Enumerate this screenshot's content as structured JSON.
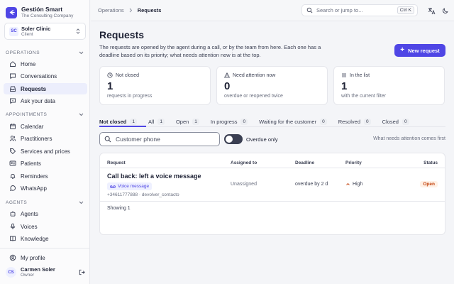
{
  "brand": {
    "name": "Gestión Smart",
    "subtitle": "The Consulting Company",
    "accent": "#4f46e5"
  },
  "clinic": {
    "initials": "SC",
    "name": "Soler Clinic",
    "role": "Client"
  },
  "sidebar": {
    "operations_label": "Operations",
    "operations": [
      {
        "label": "Home",
        "icon": "home-icon"
      },
      {
        "label": "Conversations",
        "icon": "chat-icon"
      },
      {
        "label": "Requests",
        "icon": "inbox-icon",
        "active": true
      },
      {
        "label": "Ask your data",
        "icon": "chat-question-icon"
      }
    ],
    "appointments_label": "Appointments",
    "appointments": [
      {
        "label": "Calendar",
        "icon": "calendar-icon"
      },
      {
        "label": "Practitioners",
        "icon": "users-icon"
      },
      {
        "label": "Services and prices",
        "icon": "tag-icon"
      },
      {
        "label": "Patients",
        "icon": "id-card-icon"
      },
      {
        "label": "Reminders",
        "icon": "bell-icon"
      },
      {
        "label": "WhatsApp",
        "icon": "whatsapp-icon"
      }
    ],
    "agents_label": "Agents",
    "agents": [
      {
        "label": "Agents",
        "icon": "bot-icon"
      },
      {
        "label": "Voices",
        "icon": "mic-icon"
      },
      {
        "label": "Knowledge",
        "icon": "book-icon"
      }
    ],
    "profile_label": "My profile"
  },
  "user": {
    "initials": "CS",
    "name": "Carmen Soler",
    "role": "Owner"
  },
  "topbar": {
    "breadcrumb_parent": "Operations",
    "breadcrumb_current": "Requests",
    "search_placeholder": "Search or jump to...",
    "shortcut": "Ctrl K"
  },
  "page": {
    "title": "Requests",
    "description": "The requests are opened by the agent during a call, or by the team from here. Each one has a deadline based on its priority; what needs attention now is at the top.",
    "new_button": "New request"
  },
  "cards": [
    {
      "label": "Not closed",
      "value": "1",
      "note": "requests in progress",
      "icon": "clock-icon"
    },
    {
      "label": "Need attention now",
      "value": "0",
      "note": "overdue or reopened twice",
      "icon": "alert-icon"
    },
    {
      "label": "In the list",
      "value": "1",
      "note": "with the current filter",
      "icon": "list-icon"
    }
  ],
  "tabs": [
    {
      "label": "Not closed",
      "count": "1",
      "active": true
    },
    {
      "label": "All",
      "count": "1"
    },
    {
      "label": "Open",
      "count": "1"
    },
    {
      "label": "In progress",
      "count": "0"
    },
    {
      "label": "Waiting for the customer",
      "count": "0"
    },
    {
      "label": "Resolved",
      "count": "0"
    },
    {
      "label": "Closed",
      "count": "0"
    }
  ],
  "filters": {
    "phone_placeholder": "Customer phone",
    "overdue_label": "Overdue only",
    "sort_note": "What needs attention comes first"
  },
  "table": {
    "headers": {
      "request": "Request",
      "assigned": "Assigned to",
      "deadline": "Deadline",
      "priority": "Priority",
      "status": "Status"
    },
    "rows": [
      {
        "title": "Call back: left a voice message",
        "tag": "Voice message",
        "meta": "+34611777888 · devolver_contacto",
        "assigned": "Unassigned",
        "deadline": "overdue by 2 d",
        "priority": "High",
        "status": "Open"
      }
    ],
    "footer": "Showing 1"
  }
}
